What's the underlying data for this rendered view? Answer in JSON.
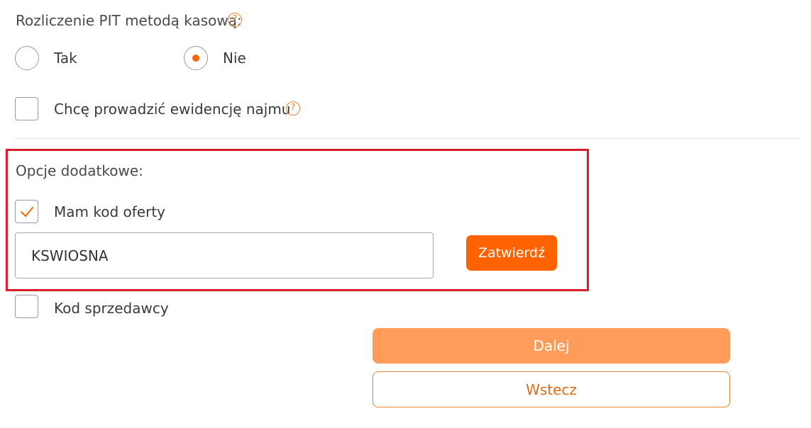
{
  "pit_settlement": {
    "label": "Rozliczenie PIT metodą kasową:",
    "help_icon": "question-circle-icon",
    "options": [
      {
        "label": "Tak",
        "selected": false
      },
      {
        "label": "Nie",
        "selected": true
      }
    ]
  },
  "rental_records": {
    "label": "Chcę prowadzić ewidencję najmu",
    "checked": false,
    "help_icon": "question-circle-icon"
  },
  "additional_options": {
    "title": "Opcje dodatkowe:",
    "offer_code": {
      "label": "Mam kod oferty",
      "checked": true,
      "input_value": "KSWIOSNA",
      "confirm_label": "Zatwierdź"
    },
    "seller_code": {
      "label": "Kod sprzedawcy",
      "checked": false
    }
  },
  "navigation": {
    "next_label": "Dalej",
    "back_label": "Wstecz"
  },
  "colors": {
    "accent": "#ff6200",
    "primary_button": "#ff9c5a",
    "highlight_border": "#d81e2b"
  }
}
